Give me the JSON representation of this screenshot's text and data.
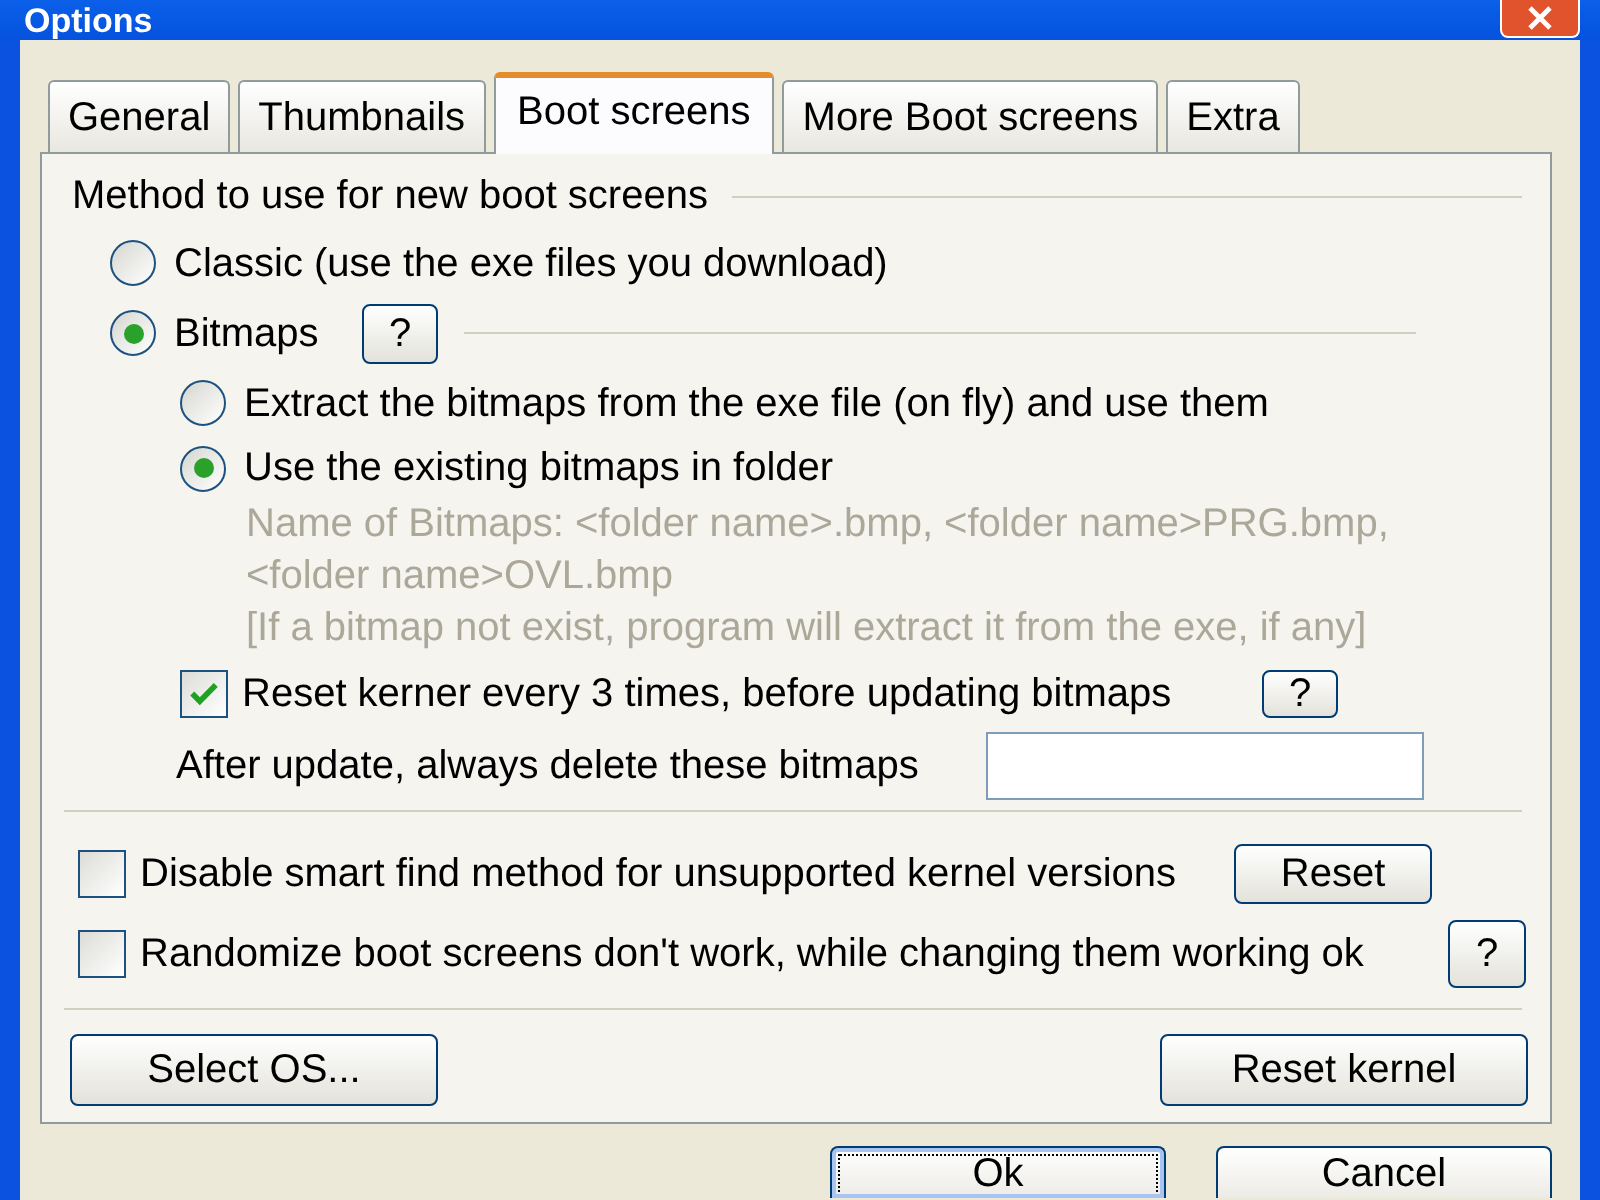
{
  "window": {
    "title": "Options"
  },
  "tabs": [
    {
      "label": "General",
      "selected": false
    },
    {
      "label": "Thumbnails",
      "selected": false
    },
    {
      "label": "Boot screens",
      "selected": true
    },
    {
      "label": "More Boot screens",
      "selected": false
    },
    {
      "label": "Extra",
      "selected": false
    }
  ],
  "method_group": {
    "label": "Method to use for new boot screens",
    "methods": [
      {
        "label": "Classic (use the exe files you download)",
        "selected": false
      },
      {
        "label": "Bitmaps",
        "selected": true,
        "help": "?"
      }
    ],
    "bitmap_modes": [
      {
        "label": "Extract the bitmaps from the exe file (on fly) and use them",
        "selected": false
      },
      {
        "label": "Use the existing bitmaps in folder",
        "selected": true
      }
    ],
    "notes": [
      "Name of Bitmaps: <folder name>.bmp, <folder name>PRG.bmp, <folder name>OVL.bmp",
      "[If a bitmap not exist, program will extract it from the exe, if any]"
    ],
    "reset_every": {
      "label": "Reset kerner every 3 times, before updating bitmaps",
      "checked": true,
      "help": "?"
    },
    "delete_field": {
      "label": "After update, always delete these bitmaps"
    }
  },
  "options": [
    {
      "label": "Disable smart find method for unsupported kernel versions",
      "checked": false,
      "button": "Reset"
    },
    {
      "label": "Randomize boot screens don't work, while changing them working ok",
      "checked": false,
      "button": "?"
    }
  ],
  "panel_buttons": [
    "Select OS...",
    "Reset kernel"
  ],
  "dialog_buttons": [
    {
      "label": "Ok",
      "focused": true
    },
    {
      "label": "Cancel",
      "focused": false
    }
  ]
}
